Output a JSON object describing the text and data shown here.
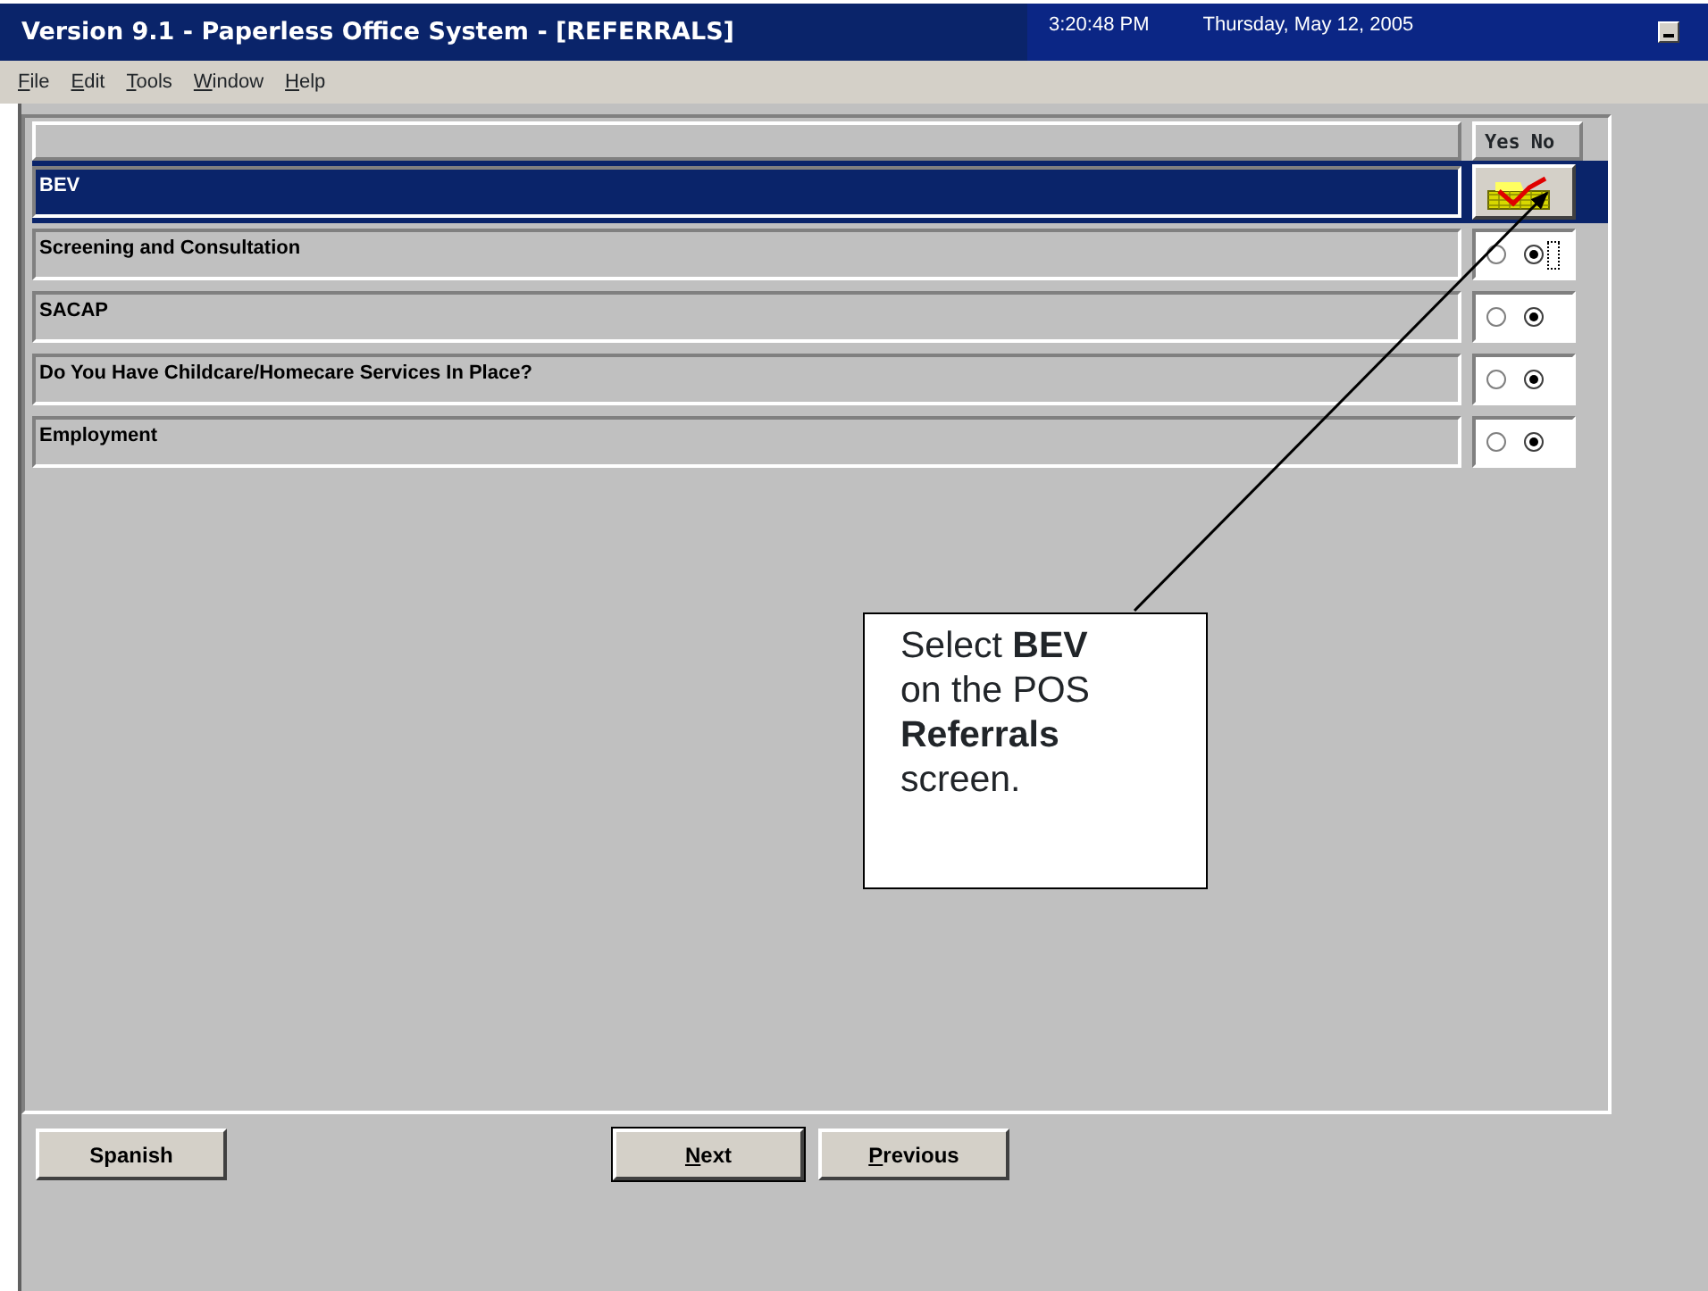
{
  "window": {
    "title": "Version 9.1 - Paperless Office System - [REFERRALS]",
    "time": "3:20:48 PM",
    "date": "Thursday, May 12, 2005"
  },
  "menu": [
    {
      "label": "File",
      "mnemonic": true
    },
    {
      "label": "Edit",
      "mnemonic": true
    },
    {
      "label": "Tools",
      "mnemonic": true
    },
    {
      "label": "Window",
      "mnemonic": true
    },
    {
      "label": "Help",
      "mnemonic": true
    }
  ],
  "table": {
    "columns": [
      {
        "label": "Yes"
      },
      {
        "label": "No"
      }
    ],
    "rows": [
      {
        "label": "BEV",
        "selected": true,
        "kind": "icon"
      },
      {
        "label": "Screening and Consultation",
        "selected": false,
        "kind": "radios",
        "focused": true,
        "options": [
          {
            "selected": false
          },
          {
            "selected": true
          }
        ]
      },
      {
        "label": "SACAP",
        "selected": false,
        "kind": "radios",
        "focused": false,
        "options": [
          {
            "selected": false
          },
          {
            "selected": true
          }
        ]
      },
      {
        "label": "Do You Have Childcare/Homecare Services In Place?",
        "selected": false,
        "kind": "radios",
        "focused": false,
        "options": [
          {
            "selected": false
          },
          {
            "selected": true
          }
        ]
      },
      {
        "label": "Employment",
        "selected": false,
        "kind": "radios",
        "focused": false,
        "options": [
          {
            "selected": false
          },
          {
            "selected": true
          }
        ]
      }
    ]
  },
  "buttons": [
    {
      "label": "Spanish",
      "mnemonic": false,
      "default": false
    },
    {
      "label": "Next",
      "mnemonic": true,
      "default": true
    },
    {
      "label": "Previous",
      "mnemonic": true,
      "default": false
    }
  ],
  "callout": {
    "text": "Select **BEV** on the POS **Referrals** screen."
  }
}
